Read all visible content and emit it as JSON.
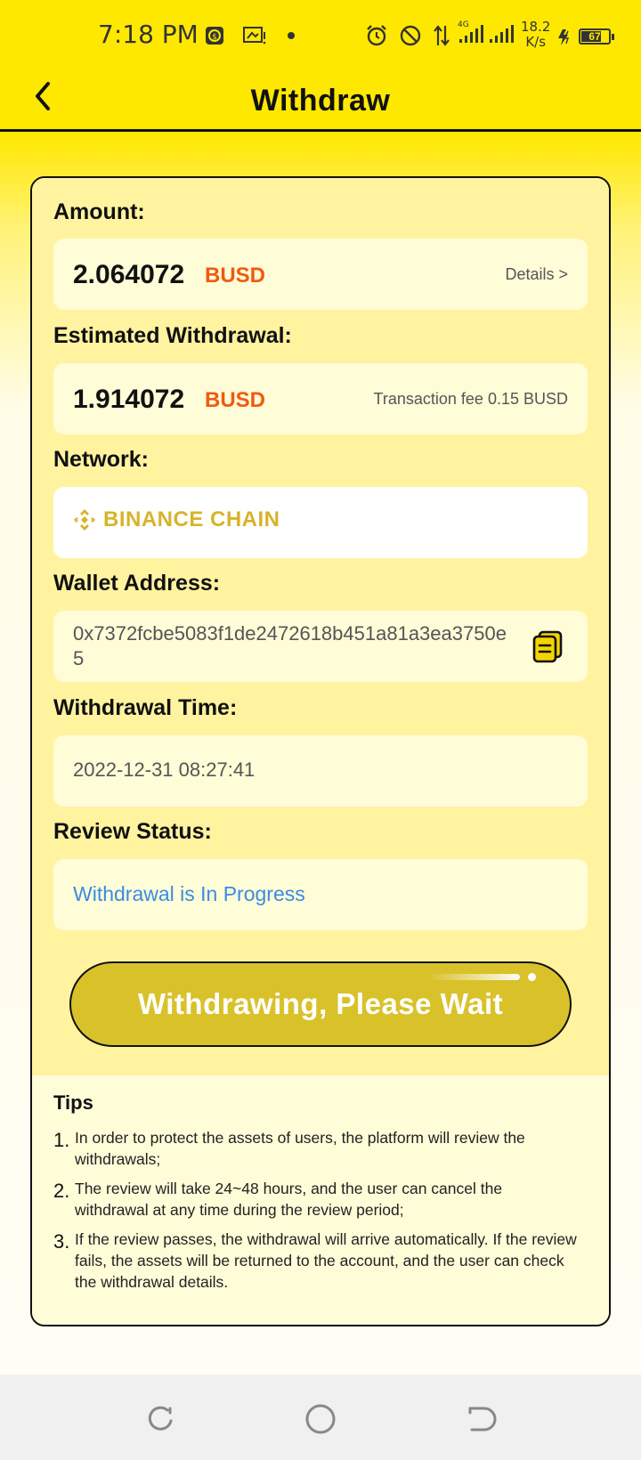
{
  "status_bar": {
    "time": "7:18 PM",
    "net_speed_value": "18.2",
    "net_speed_unit": "K/s",
    "battery": "67",
    "network_type": "4G",
    "icons": [
      "app-notification-icon",
      "screenshot-icon",
      "dot-icon",
      "alarm-icon",
      "do-not-disturb-icon",
      "data-transfer-icon",
      "signal-icon",
      "signal-icon",
      "charging-icon",
      "battery-icon"
    ]
  },
  "header": {
    "title": "Withdraw",
    "back_icon": "chevron-left-icon"
  },
  "amount": {
    "label": "Amount:",
    "value": "2.064072",
    "currency": "BUSD",
    "details_link": "Details >"
  },
  "estimated": {
    "label": "Estimated Withdrawal:",
    "value": "1.914072",
    "currency": "BUSD",
    "fee_text": "Transaction fee 0.15 BUSD"
  },
  "network": {
    "label": "Network:",
    "value": "BINANCE CHAIN",
    "icon": "binance-logo-icon"
  },
  "wallet": {
    "label": "Wallet Address:",
    "address": "0x7372fcbe5083f1de2472618b451a81a3ea3750e5",
    "copy_icon": "copy-icon"
  },
  "withdrawal_time": {
    "label": "Withdrawal Time:",
    "value": "2022-12-31 08:27:41"
  },
  "review_status": {
    "label": "Review Status:",
    "value": "Withdrawal is In Progress"
  },
  "main_button": {
    "label": "Withdrawing, Please Wait"
  },
  "tips": {
    "title": "Tips",
    "items": [
      {
        "num": "1.",
        "text": "In order to protect the assets of users, the platform will review the withdrawals;"
      },
      {
        "num": "2.",
        "text": "The review will take 24~48 hours, and the user can cancel the withdrawal at any time during the review period;"
      },
      {
        "num": "3.",
        "text": "If the review passes, the withdrawal will arrive automatically. If the review fails, the assets will be returned to the account, and the user can check the withdrawal details."
      }
    ]
  },
  "colors": {
    "header_yellow": "#ffe800",
    "card_bg": "#fff3a0",
    "currency_orange": "#f05a10",
    "status_blue": "#3a8ce0",
    "button_gold": "#d9c12a",
    "binance_gold": "#d6b42a"
  },
  "navbar": {
    "icons": [
      "recent-apps-icon",
      "home-icon",
      "back-nav-icon"
    ]
  }
}
